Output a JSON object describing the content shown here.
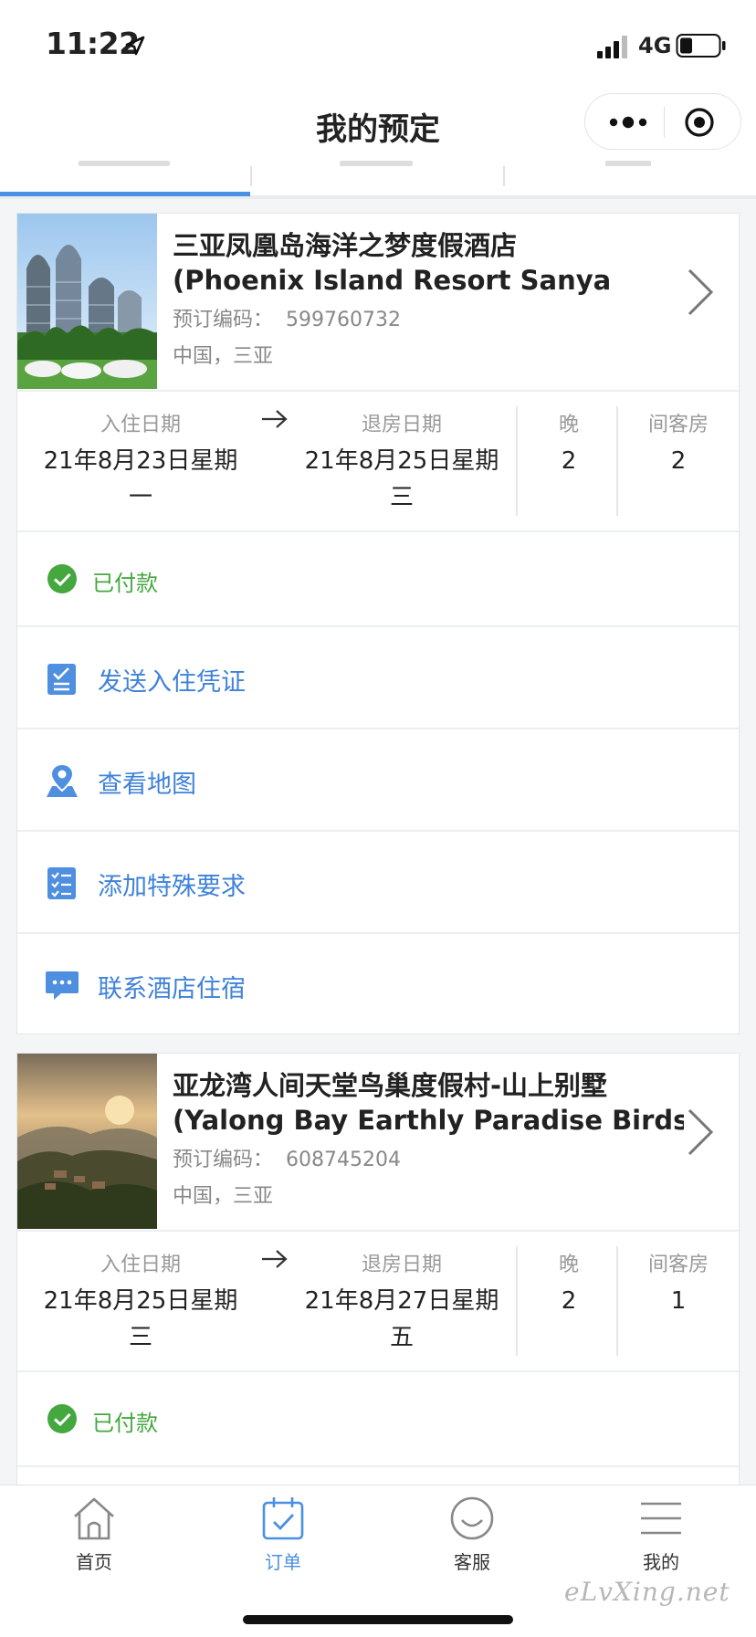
{
  "status_bar": {
    "time": "11:22",
    "network": "4G"
  },
  "nav": {
    "title": "我的预定"
  },
  "bookings": [
    {
      "name_cn": "三亚凤凰岛海洋之梦度假酒店",
      "name_en": "(Phoenix Island Resort Sanya",
      "ref_label": "预订编码：",
      "ref_value": "599760732",
      "location": "中国，三亚",
      "checkin_label": "入住日期",
      "checkin_date": "21年8月23日星期",
      "checkin_weekday": "一",
      "checkout_label": "退房日期",
      "checkout_date": "21年8月25日星期",
      "checkout_weekday": "三",
      "nights_label": "晚",
      "nights": "2",
      "rooms_label": "间客房",
      "rooms": "2",
      "status": "已付款"
    },
    {
      "name_cn": "亚龙湾人间天堂鸟巢度假村-山上别墅",
      "name_en": "(Yalong Bay Earthly Paradise Birds",
      "ref_label": "预订编码：",
      "ref_value": "608745204",
      "location": "中国，三亚",
      "checkin_label": "入住日期",
      "checkin_date": "21年8月25日星期",
      "checkin_weekday": "三",
      "checkout_label": "退房日期",
      "checkout_date": "21年8月27日星期",
      "checkout_weekday": "五",
      "nights_label": "晚",
      "nights": "2",
      "rooms_label": "间客房",
      "rooms": "1",
      "status": "已付款"
    }
  ],
  "actions": [
    {
      "label": "发送入住凭证",
      "icon": "voucher-icon"
    },
    {
      "label": "查看地图",
      "icon": "map-pin-icon"
    },
    {
      "label": "添加特殊要求",
      "icon": "checklist-icon"
    },
    {
      "label": "联系酒店住宿",
      "icon": "chat-icon"
    }
  ],
  "tabbar": {
    "items": [
      {
        "label": "首页",
        "icon": "home-icon"
      },
      {
        "label": "订单",
        "icon": "calendar-check-icon"
      },
      {
        "label": "客服",
        "icon": "smile-icon"
      },
      {
        "label": "我的",
        "icon": "menu-icon"
      }
    ],
    "active_index": 1
  },
  "watermark": "eLvXing.net",
  "colors": {
    "accent": "#4a90e2",
    "link": "#3f82d8",
    "paid": "#44a83f",
    "page_bg": "#f4f5f7"
  }
}
